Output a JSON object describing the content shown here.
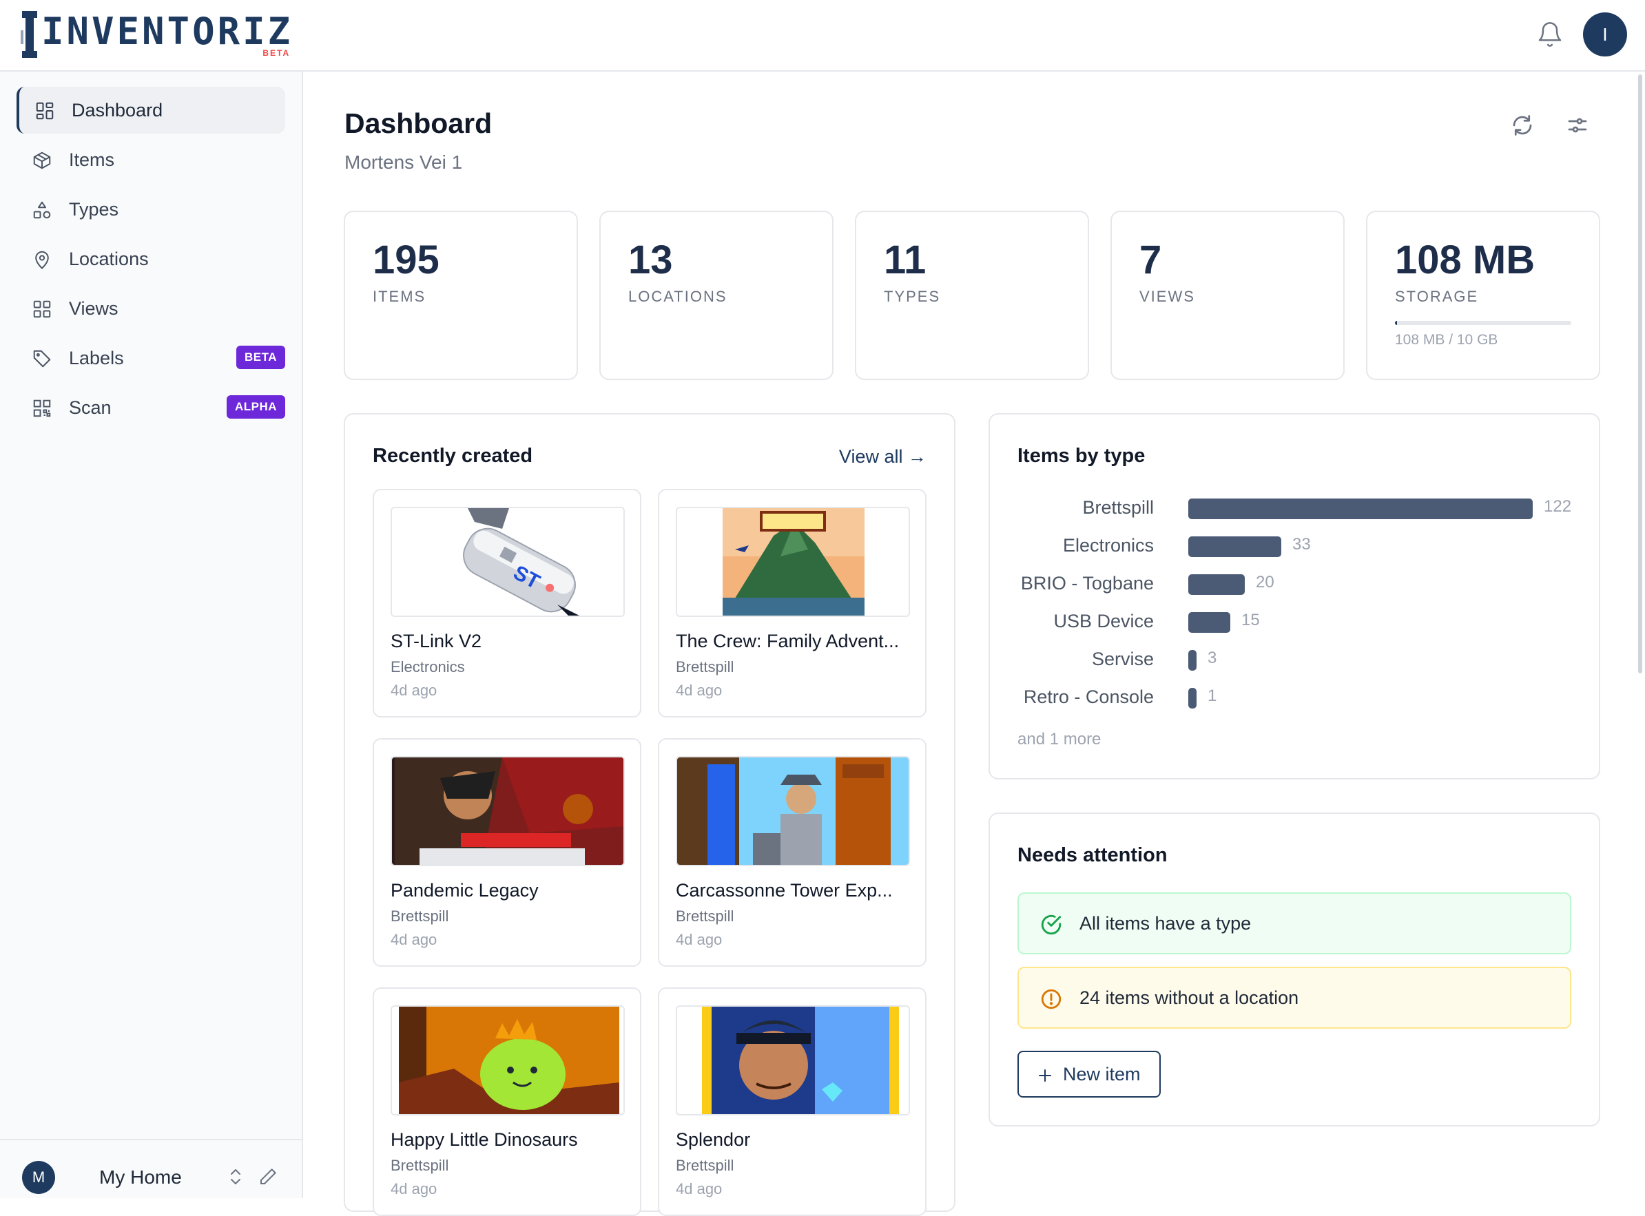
{
  "app": {
    "logo_text": "INVENTORIZ",
    "logo_badge": "BETA",
    "avatar_initial": "I"
  },
  "sidebar": {
    "items": [
      {
        "label": "Dashboard",
        "icon": "grid-icon",
        "active": true
      },
      {
        "label": "Items",
        "icon": "box-icon"
      },
      {
        "label": "Types",
        "icon": "shapes-icon"
      },
      {
        "label": "Locations",
        "icon": "map-pin-icon"
      },
      {
        "label": "Views",
        "icon": "grid-icon"
      },
      {
        "label": "Labels",
        "icon": "tag-icon",
        "badge": "BETA"
      },
      {
        "label": "Scan",
        "icon": "qr-icon",
        "badge": "ALPHA"
      }
    ],
    "footer": {
      "avatar_initial": "M",
      "label": "My Home"
    }
  },
  "header": {
    "title": "Dashboard",
    "subtitle": "Mortens Vei 1"
  },
  "stats": [
    {
      "value": "195",
      "label": "ITEMS"
    },
    {
      "value": "13",
      "label": "LOCATIONS"
    },
    {
      "value": "11",
      "label": "TYPES"
    },
    {
      "value": "7",
      "label": "VIEWS"
    },
    {
      "value": "108 MB",
      "label": "STORAGE",
      "usage_text": "108 MB / 10 GB",
      "usage_fraction": 0.0105
    }
  ],
  "recent": {
    "title": "Recently created",
    "view_all": "View all",
    "items": [
      {
        "name": "ST-Link V2",
        "type": "Electronics",
        "age": "4d ago"
      },
      {
        "name": "The Crew: Family Advent...",
        "type": "Brettspill",
        "age": "4d ago"
      },
      {
        "name": "Pandemic Legacy",
        "type": "Brettspill",
        "age": "4d ago"
      },
      {
        "name": "Carcassonne Tower Exp...",
        "type": "Brettspill",
        "age": "4d ago"
      },
      {
        "name": "Happy Little Dinosaurs",
        "type": "Brettspill",
        "age": "4d ago"
      },
      {
        "name": "Splendor",
        "type": "Brettspill",
        "age": "4d ago"
      }
    ]
  },
  "items_by_type": {
    "title": "Items by type",
    "rows": [
      {
        "label": "Brettspill",
        "value": 122
      },
      {
        "label": "Electronics",
        "value": 33
      },
      {
        "label": "BRIO - Togbane",
        "value": 20
      },
      {
        "label": "USB Device",
        "value": 15
      },
      {
        "label": "Servise",
        "value": 3
      },
      {
        "label": "Retro - Console",
        "value": 1
      }
    ],
    "more": "and 1 more"
  },
  "attention": {
    "title": "Needs attention",
    "ok_text": "All items have a type",
    "warn_text": "24 items without a location",
    "new_item": "New item"
  },
  "colors": {
    "primary": "#1e3a5f",
    "badge": "#6d28d9",
    "bar": "#4b5a75"
  }
}
